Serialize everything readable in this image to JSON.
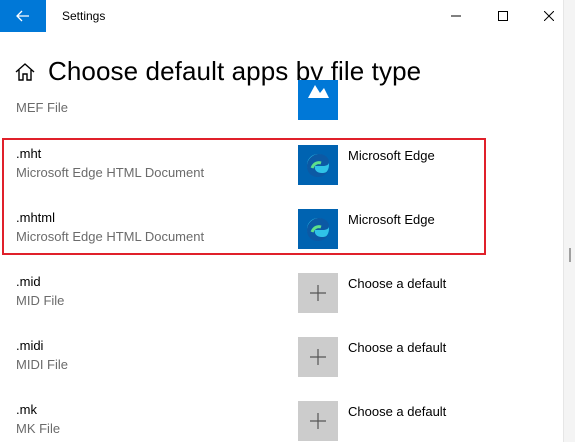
{
  "window": {
    "title": "Settings",
    "controls": [
      "minimize",
      "maximize",
      "close"
    ]
  },
  "page": {
    "title": "Choose default apps by file type"
  },
  "rows": [
    {
      "ext": "",
      "desc": "MEF File",
      "app": "",
      "app_icon": "photos-icon"
    },
    {
      "ext": ".mht",
      "desc": "Microsoft Edge HTML Document",
      "app": "Microsoft Edge",
      "app_icon": "edge-icon"
    },
    {
      "ext": ".mhtml",
      "desc": "Microsoft Edge HTML Document",
      "app": "Microsoft Edge",
      "app_icon": "edge-icon"
    },
    {
      "ext": ".mid",
      "desc": "MID File",
      "app": "Choose a default",
      "app_icon": "plus-icon"
    },
    {
      "ext": ".midi",
      "desc": "MIDI File",
      "app": "Choose a default",
      "app_icon": "plus-icon"
    },
    {
      "ext": ".mk",
      "desc": "MK File",
      "app": "Choose a default",
      "app_icon": "plus-icon"
    }
  ],
  "colors": {
    "accent": "#0078d7",
    "highlight": "#e0202a",
    "tile_default": "#cccccc"
  }
}
